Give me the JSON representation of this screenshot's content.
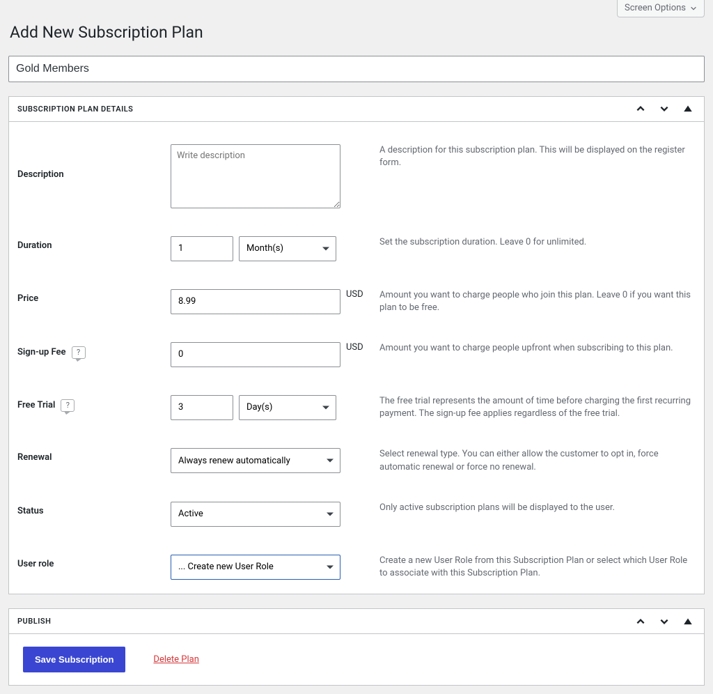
{
  "screen_options_label": "Screen Options",
  "page_title": "Add New Subscription Plan",
  "title_value": "Gold Members",
  "details_box": {
    "title": "SUBSCRIPTION PLAN DETAILS",
    "description": {
      "label": "Description",
      "placeholder": "Write description",
      "value": "",
      "help": "A description for this subscription plan. This will be displayed on the register form."
    },
    "duration": {
      "label": "Duration",
      "value": "1",
      "unit": "Month(s)",
      "help": "Set the subscription duration. Leave 0 for unlimited."
    },
    "price": {
      "label": "Price",
      "value": "8.99",
      "currency": "USD",
      "help": "Amount you want to charge people who join this plan. Leave 0 if you want this plan to be free."
    },
    "signup_fee": {
      "label": "Sign-up Fee",
      "value": "0",
      "currency": "USD",
      "help": "Amount you want to charge people upfront when subscribing to this plan."
    },
    "free_trial": {
      "label": "Free Trial",
      "value": "3",
      "unit": "Day(s)",
      "help": "The free trial represents the amount of time before charging the first recurring payment. The sign-up fee applies regardless of the free trial."
    },
    "renewal": {
      "label": "Renewal",
      "value": "Always renew automatically",
      "help": "Select renewal type. You can either allow the customer to opt in, force automatic renewal or force no renewal."
    },
    "status": {
      "label": "Status",
      "value": "Active",
      "help": "Only active subscription plans will be displayed to the user."
    },
    "user_role": {
      "label": "User role",
      "value": "... Create new User Role",
      "help": "Create a new User Role from this Subscription Plan or select which User Role to associate with this Subscription Plan."
    }
  },
  "publish_box": {
    "title": "PUBLISH",
    "save_label": "Save Subscription",
    "delete_label": "Delete Plan"
  }
}
